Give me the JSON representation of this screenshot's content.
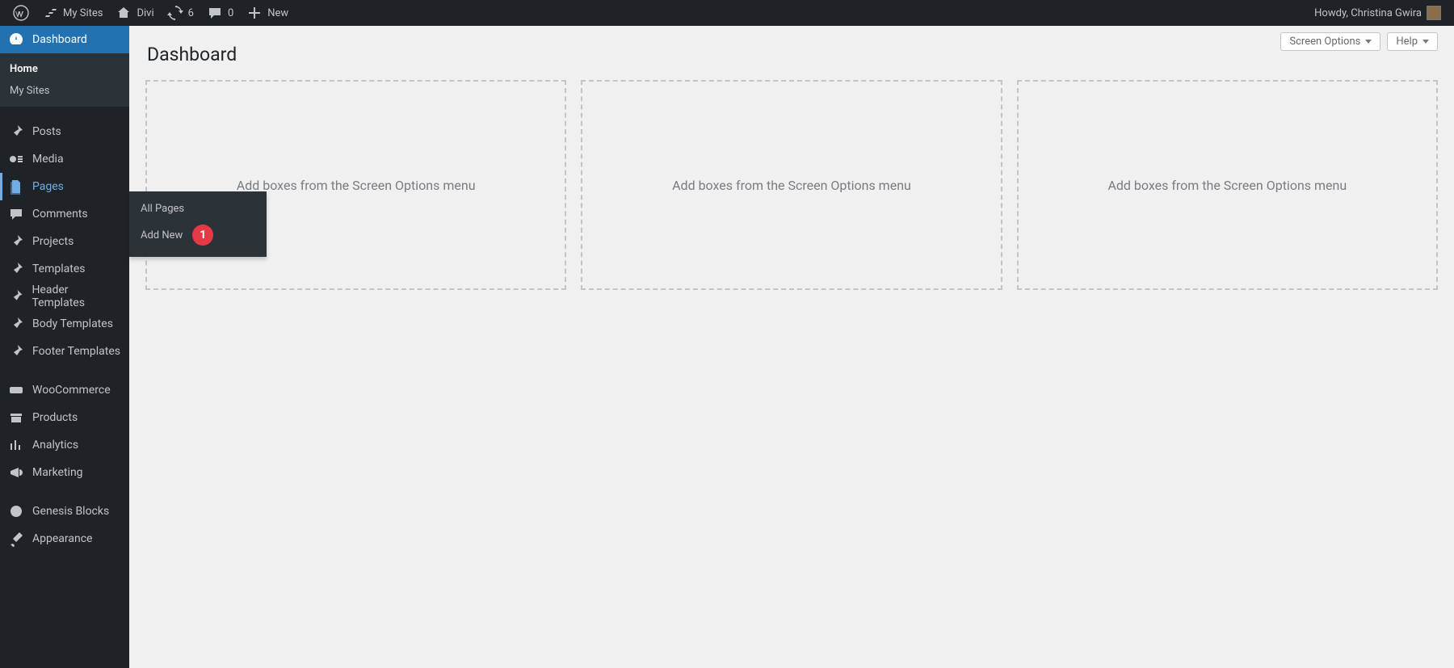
{
  "adminbar": {
    "my_sites": "My Sites",
    "site_name": "Divi",
    "update_count": "6",
    "comment_count": "0",
    "new_label": "New",
    "howdy": "Howdy, Christina Gwira"
  },
  "content": {
    "title": "Dashboard",
    "screen_options_label": "Screen Options",
    "help_label": "Help",
    "box_placeholder": "Add boxes from the Screen Options menu"
  },
  "sidebar": {
    "dashboard": "Dashboard",
    "dashboard_sub": {
      "home": "Home",
      "my_sites": "My Sites"
    },
    "posts": "Posts",
    "media": "Media",
    "pages": "Pages",
    "pages_sub": {
      "all": "All Pages",
      "add_new": "Add New",
      "badge": "1"
    },
    "comments": "Comments",
    "projects": "Projects",
    "templates": "Templates",
    "header_templates": "Header Templates",
    "body_templates": "Body Templates",
    "footer_templates": "Footer Templates",
    "woocommerce": "WooCommerce",
    "products": "Products",
    "analytics": "Analytics",
    "marketing": "Marketing",
    "genesis_blocks": "Genesis Blocks",
    "appearance": "Appearance"
  }
}
